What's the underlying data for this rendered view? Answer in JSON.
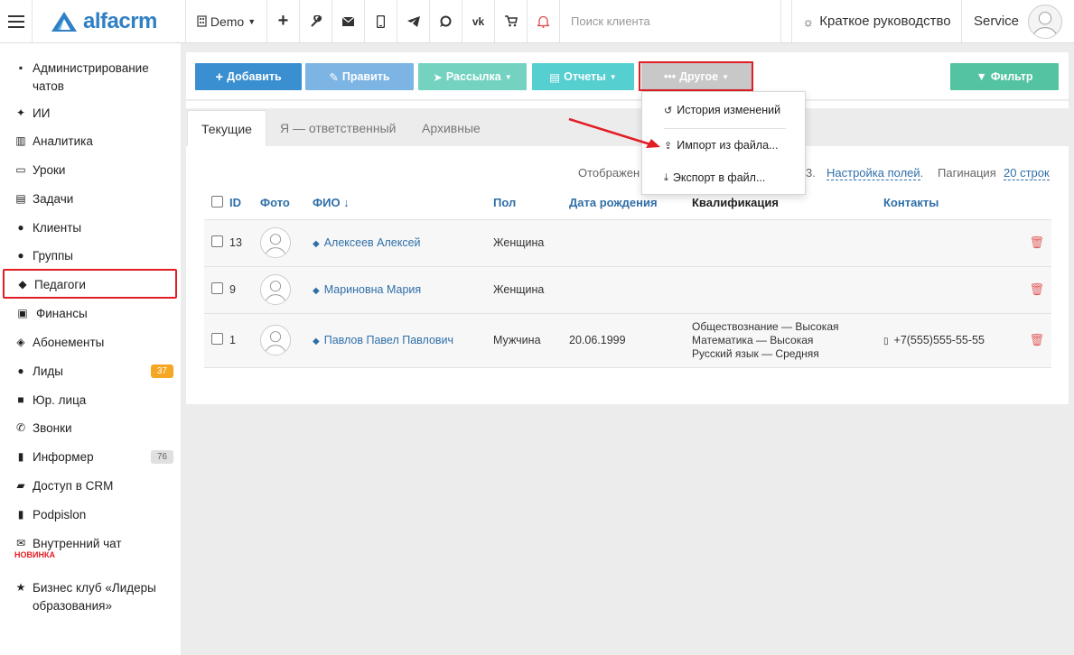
{
  "topbar": {
    "logo_text": "alfacrm",
    "demo_label": "Demo",
    "search_placeholder": "Поиск клиента",
    "guide_label": "Краткое руководство",
    "user_label": "Service",
    "icons": [
      "plus-icon",
      "wrench-icon",
      "envelope-icon",
      "mobile-icon",
      "telegram-icon",
      "whatsapp-icon",
      "vk-icon",
      "cart-icon",
      "bell-icon"
    ]
  },
  "sidebar": {
    "items": [
      {
        "label": "Администрирование чатов",
        "icon": "chat-icon"
      },
      {
        "label": "ИИ",
        "icon": "sparkles-icon"
      },
      {
        "label": "Аналитика",
        "icon": "map-icon"
      },
      {
        "label": "Уроки",
        "icon": "calendar-icon"
      },
      {
        "label": "Задачи",
        "icon": "clipboard-icon"
      },
      {
        "label": "Клиенты",
        "icon": "user-icon"
      },
      {
        "label": "Группы",
        "icon": "users-icon"
      },
      {
        "label": "Педагоги",
        "icon": "graduation-cap-icon"
      },
      {
        "label": "Финансы",
        "icon": "money-icon"
      },
      {
        "label": "Абонементы",
        "icon": "tag-icon"
      },
      {
        "label": "Лиды",
        "icon": "user-plus-icon",
        "badge": "37"
      },
      {
        "label": "Юр. лица",
        "icon": "briefcase-icon"
      },
      {
        "label": "Звонки",
        "icon": "phone-icon"
      },
      {
        "label": "Информер",
        "icon": "book-icon",
        "badge": "76"
      },
      {
        "label": "Доступ в CRM",
        "icon": "lock-icon"
      },
      {
        "label": "Podpislon",
        "icon": "file-icon"
      },
      {
        "label": "Внутренний чат",
        "icon": "envelope-icon",
        "tag": "НОВИНКА"
      },
      {
        "label": "Бизнес клуб «Лидеры образования»",
        "icon": "star-icon"
      }
    ],
    "colors": {
      "badge_leads": "#f5a623",
      "badge_informer": "#e0e0e0",
      "highlight": "#e21d24"
    }
  },
  "toolbar": {
    "add": "Добавить",
    "edit": "Править",
    "mailing": "Рассылка",
    "reports": "Отчеты",
    "other": "Другое",
    "filter": "Фильтр",
    "colors": {
      "add": "#3a8fd1",
      "edit": "#7cb4e3",
      "mailing": "#73d3c0",
      "reports": "#56cfd1",
      "other": "#c8c8c8",
      "filter": "#53c3a1"
    }
  },
  "dropdown": {
    "history": "История изменений",
    "import": "Импорт из файла...",
    "export": "Экспорт в файл..."
  },
  "tabs": {
    "current": "Текущие",
    "responsible": "Я — ответственный",
    "archive": "Архивные"
  },
  "display": {
    "shown_prefix": "Отображен",
    "shown_suffix": "3.",
    "settings_link": "Настройка полей",
    "pagination_label": "Пагинация",
    "pagination_value": "20 строк"
  },
  "table": {
    "headers": {
      "id": "ID",
      "photo": "Фото",
      "name": "ФИО ↓",
      "gender": "Пол",
      "birth": "Дата рождения",
      "qual": "Квалификация",
      "contacts": "Контакты"
    },
    "rows": [
      {
        "id": "13",
        "name": "Алексеев Алексей",
        "gender": "Женщина",
        "birth": "",
        "qual": [
          "",
          "",
          ""
        ],
        "phone": ""
      },
      {
        "id": "9",
        "name": "Мариновна Мария",
        "gender": "Женщина",
        "birth": "",
        "qual": [
          "",
          "",
          ""
        ],
        "phone": ""
      },
      {
        "id": "1",
        "name": "Павлов Павел Павлович",
        "gender": "Мужчина",
        "birth": "20.06.1999",
        "qual": [
          "Обществознание — Высокая",
          "Математика — Высокая",
          "Русский язык — Средняя"
        ],
        "phone": "+7(555)555-55-55"
      }
    ]
  }
}
